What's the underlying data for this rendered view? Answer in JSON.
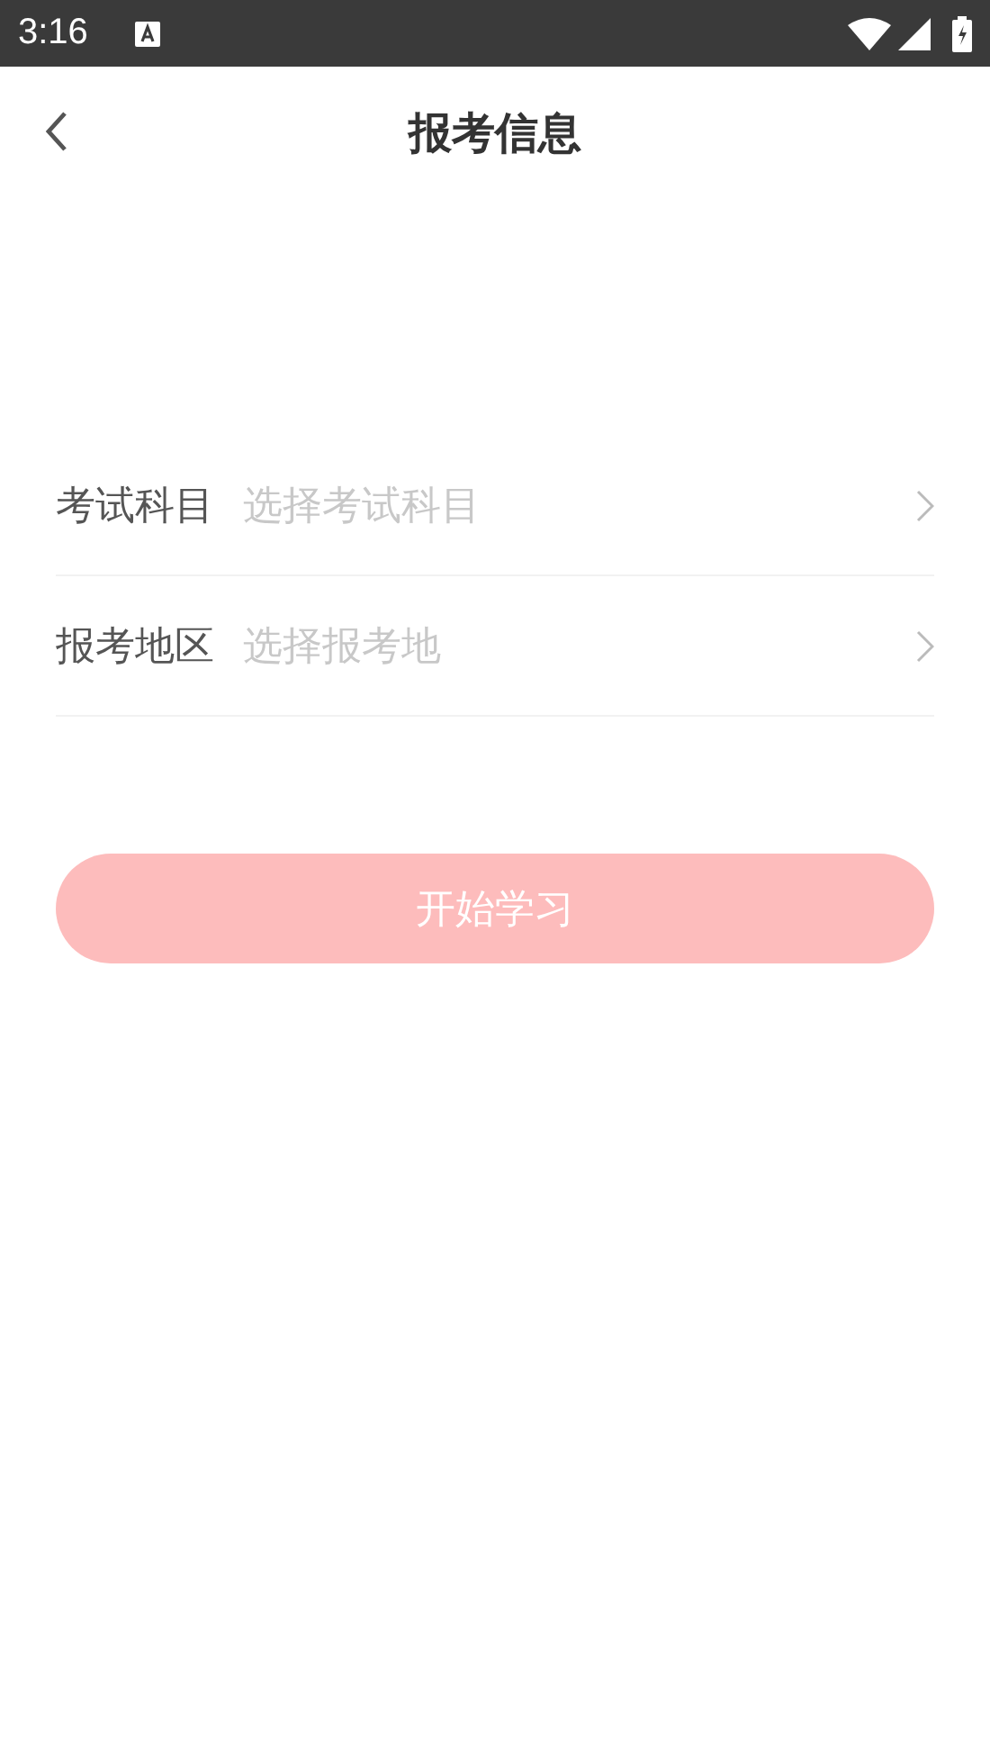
{
  "status_bar": {
    "time": "3:16"
  },
  "nav": {
    "title": "报考信息"
  },
  "fields": [
    {
      "label": "考试科目",
      "placeholder": "选择考试科目"
    },
    {
      "label": "报考地区",
      "placeholder": "选择报考地"
    }
  ],
  "button": {
    "label": "开始学习",
    "disabled": true
  }
}
